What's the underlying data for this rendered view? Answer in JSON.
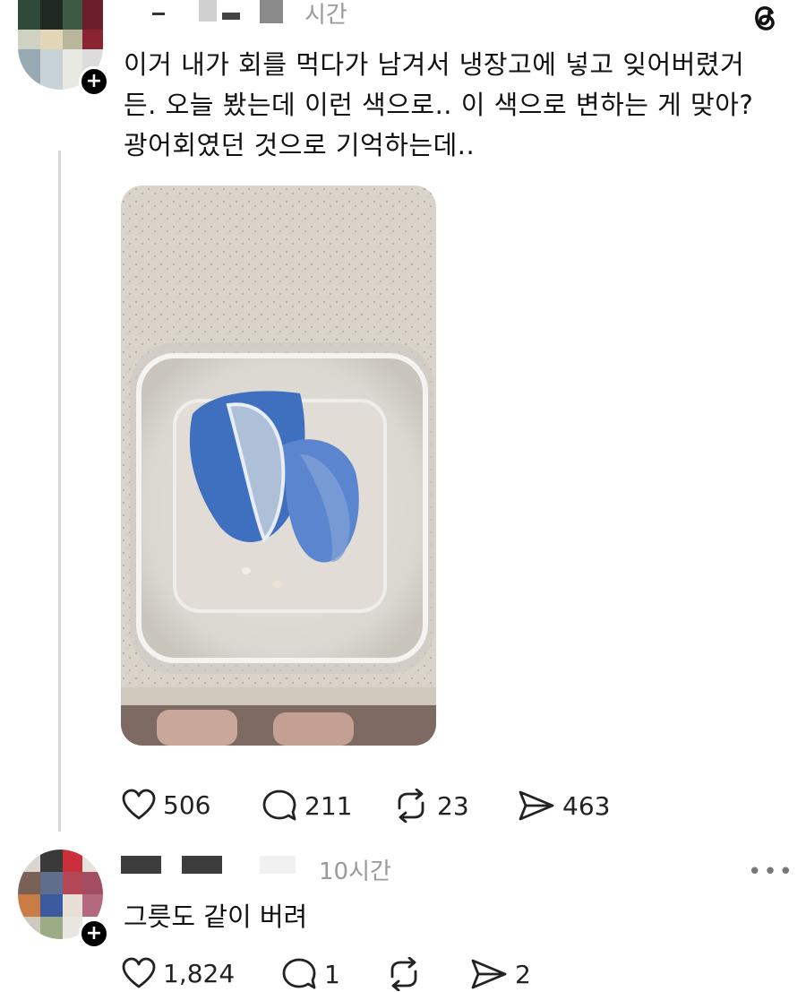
{
  "post": {
    "time_label": "시간",
    "text_line1": "이거 내가 회를 먹다가 남겨서 냉장고에 넣고 잊어버렸거",
    "text_line2": "든. 오늘 봤는데 이런 색으로.. 이 색으로 변하는 게 맞아?",
    "text_line3": "광어회였던 것으로 기억하는데..",
    "likes": "506",
    "comments": "211",
    "reposts": "23",
    "shares": "463"
  },
  "reply": {
    "time_label": "10시간",
    "text": "그릇도 같이 버려",
    "likes": "1,824",
    "comments": "1",
    "shares": "2"
  },
  "icons": {
    "app_logo": "threads-logo-icon",
    "like": "heart-icon",
    "comment": "comment-bubble-icon",
    "repost": "repost-icon",
    "share": "send-icon",
    "more": "more-dots-icon",
    "follow": "plus-icon"
  },
  "colors": {
    "text": "#111111",
    "muted": "#9a9a9a",
    "thread_line": "#d7d7d7",
    "badge": "#000000"
  }
}
